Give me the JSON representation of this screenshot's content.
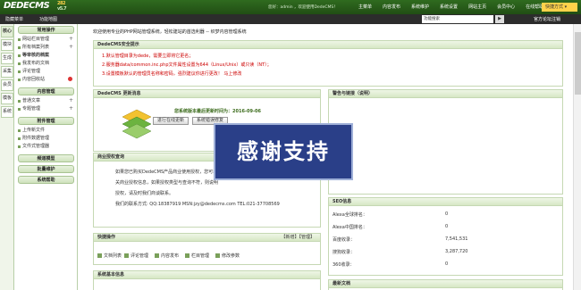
{
  "header": {
    "logo": "DEDECMS",
    "logo_sup": "282",
    "version": "v5.7",
    "welcome": "您好：admin ，欢迎使用DedeCMS！",
    "nav": [
      "主菜单",
      "内容发布",
      "系统维护",
      "系统设置",
      "网站主页",
      "会员中心",
      "在线帮助"
    ],
    "quick": "快捷方式 ▾"
  },
  "subbar": {
    "hide_menu": "隐藏菜单",
    "site_map": "功能地图",
    "search_value": "功能搜索",
    "search_btn": "▶",
    "site_link": "官方论坛",
    "exit": "注销"
  },
  "left_tabs": [
    "核心",
    "模块",
    "生成",
    "采集",
    "会员",
    "模板",
    "系统"
  ],
  "menu": {
    "sections": [
      {
        "title": "常用操作",
        "items": [
          "网站栏目管理",
          "所有档案列表",
          "等审核的档案",
          "我发布的文档",
          "评论管理",
          "内容回收站"
        ]
      },
      {
        "title": "内容管理",
        "items": [
          "普通文章",
          "专题管理"
        ]
      },
      {
        "title": "附件管理",
        "items": [
          "上传新文件",
          "附件数据管理",
          "文件式管理器"
        ]
      },
      {
        "title": "频道模型",
        "items": []
      },
      {
        "title": "批量维护",
        "items": []
      },
      {
        "title": "系统帮助",
        "items": []
      }
    ]
  },
  "main": {
    "intro": "欢迎使用专业的PHP网站管理系统，轻松建站的首选利器 -- 织梦内容管理系统",
    "security": {
      "title": "DedeCMS安全提示",
      "lines": [
        "1.默认管理目录为dede，需要立即将它更名；",
        "2.服务器data/common.inc.php文件属性设置为644（Linux/Unix）或只读（NT）；",
        "3.设置模板默认的管理员名称和密码，强烈建议你进行更改！ 马上修改"
      ]
    },
    "update": {
      "title": "DedeCMS 更新消息",
      "latest": "您系统版本最后更新时间为：2016-09-06",
      "btn_update": "进行在线更新",
      "btn_repair": "系统错误修复"
    },
    "license": {
      "title": "商业授权查询",
      "lines": [
        "如果您已购买DedeCMS产品商业使用授权，您可以在",
        "关商业授权信息，如果授权类型与查询不符，则说明",
        "授权，请及时我们商谈联系。",
        "我们的联系方式: QQ:18387919 MSN:jzy@dedecms.com TEL:021-37708569"
      ]
    },
    "watermark": "感谢支持",
    "quick_ops": {
      "title": "快捷操作",
      "right": "【新增】【管理】",
      "items": [
        "文档列表",
        "评论管理",
        "内容发布",
        "栏目管理",
        "修改参数"
      ]
    },
    "sysinfo_title": "系统基本信息",
    "help": {
      "title": "警告与链接（说明）"
    },
    "seo": {
      "title": "SEO信息",
      "rows": [
        {
          "k": "Alexa全球排名：",
          "v": "0"
        },
        {
          "k": "Alexa中国排名：",
          "v": "0"
        },
        {
          "k": "百度收录：",
          "v": "7,541,531"
        },
        {
          "k": "搜狗收录：",
          "v": "3,287,720"
        },
        {
          "k": "360收录：",
          "v": "0"
        }
      ]
    },
    "latest_docs": "最新文档"
  }
}
